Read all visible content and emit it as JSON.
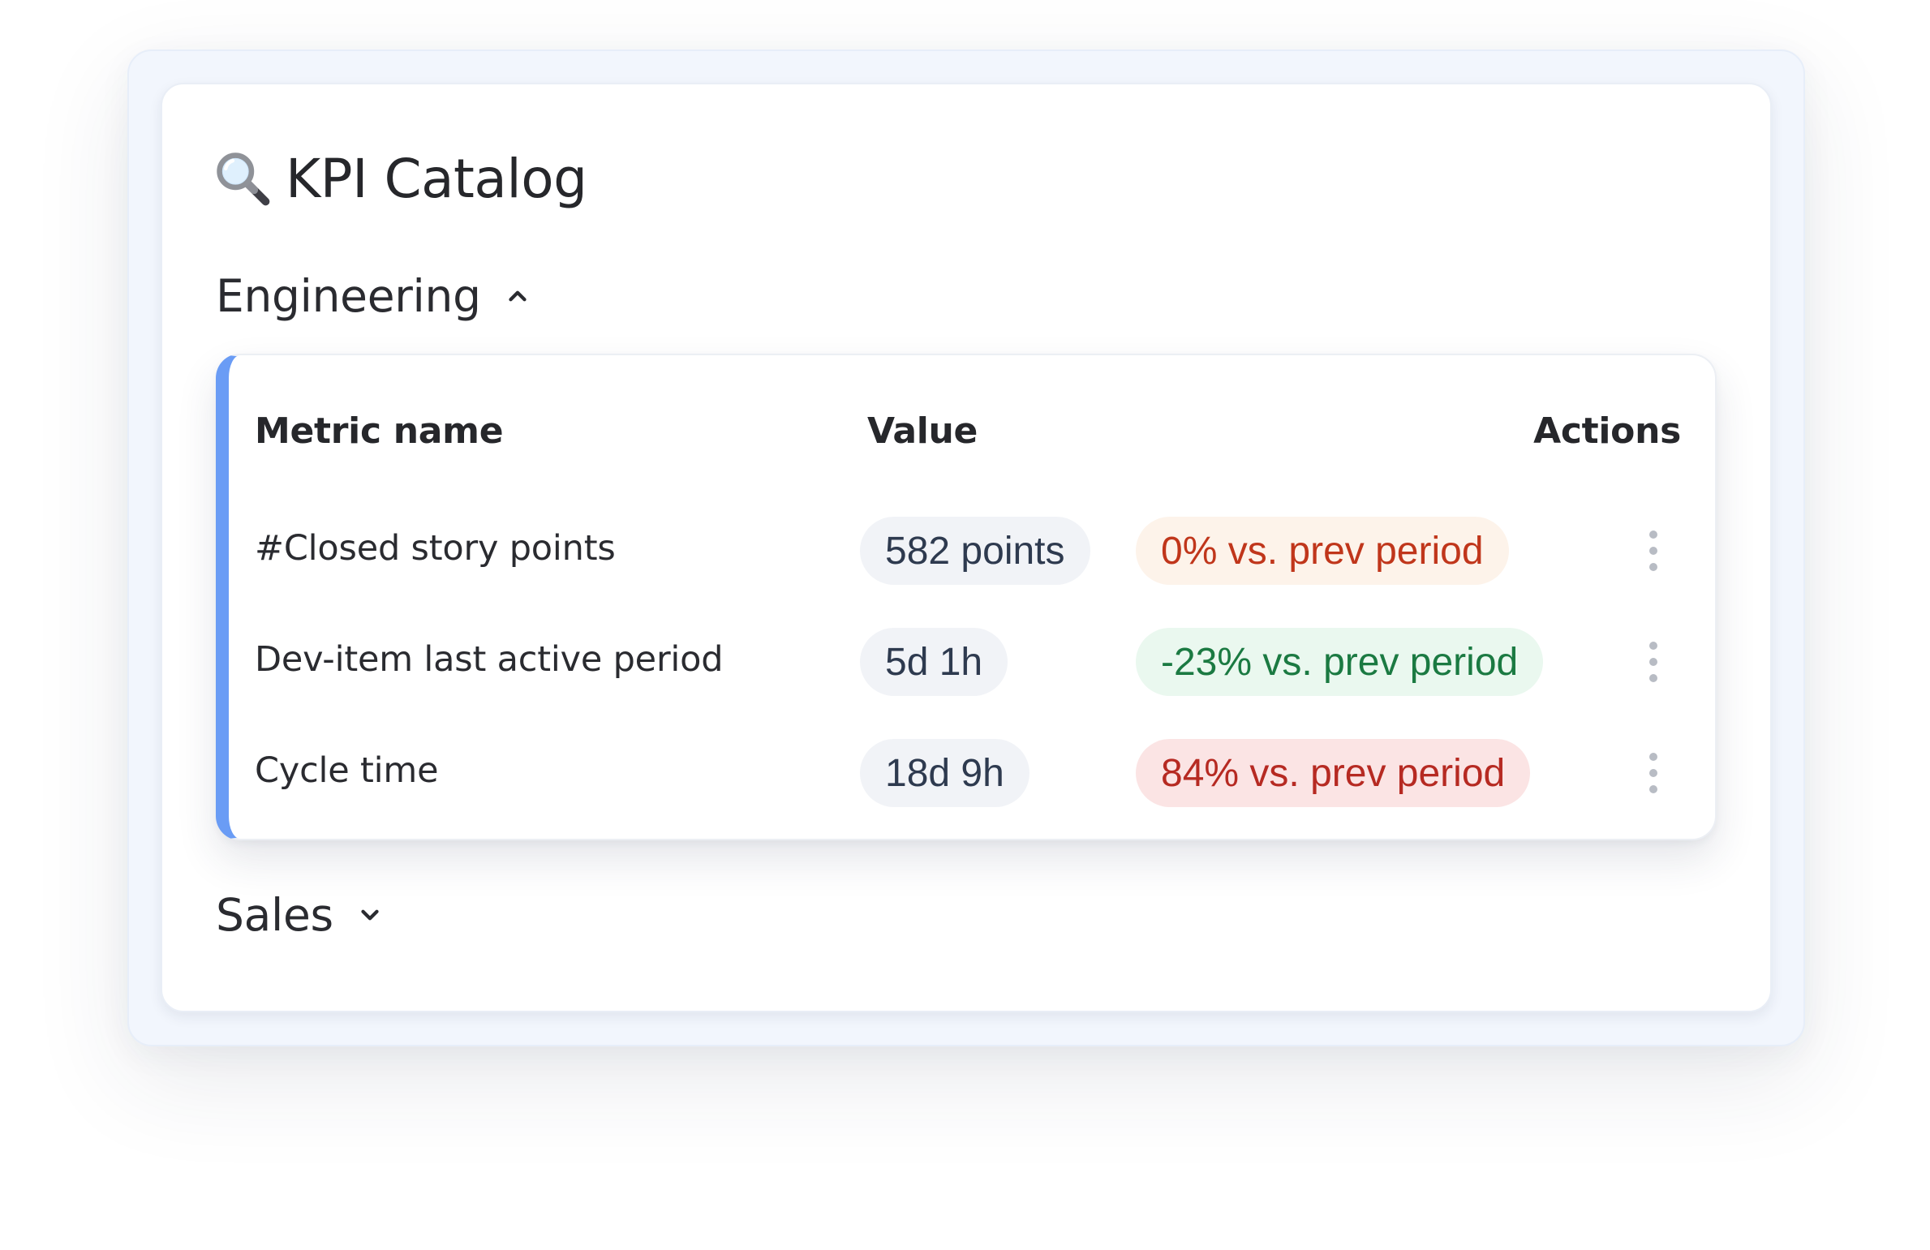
{
  "title": {
    "icon": "magnifying-glass-icon",
    "text": "KPI Catalog"
  },
  "sections": [
    {
      "label": "Engineering",
      "expanded": true,
      "chevron_icon": "chevron-up-icon"
    },
    {
      "label": "Sales",
      "expanded": false,
      "chevron_icon": "chevron-down-icon"
    }
  ],
  "table": {
    "headers": {
      "name": "Metric name",
      "value": "Value",
      "actions": "Actions"
    },
    "rows": [
      {
        "name": "#Closed story points",
        "value": "582 points",
        "change": "0% vs. prev period",
        "trend": "neutral"
      },
      {
        "name": "Dev-item last active period",
        "value": "5d 1h",
        "change": "-23% vs. prev period",
        "trend": "good"
      },
      {
        "name": "Cycle time",
        "value": "18d 9h",
        "change": "84% vs. prev period",
        "trend": "bad"
      }
    ],
    "row_action_icon": "more-vertical-icon"
  },
  "colors": {
    "accent": "#6a9cf5",
    "trend_neutral_text": "#c0361b",
    "trend_neutral_bg": "#fdf3ea",
    "trend_good_text": "#1b7a42",
    "trend_good_bg": "#eaf8ef",
    "trend_bad_text": "#b62a22",
    "trend_bad_bg": "#fbe4e4",
    "value_pill_bg": "#f1f3f7"
  }
}
